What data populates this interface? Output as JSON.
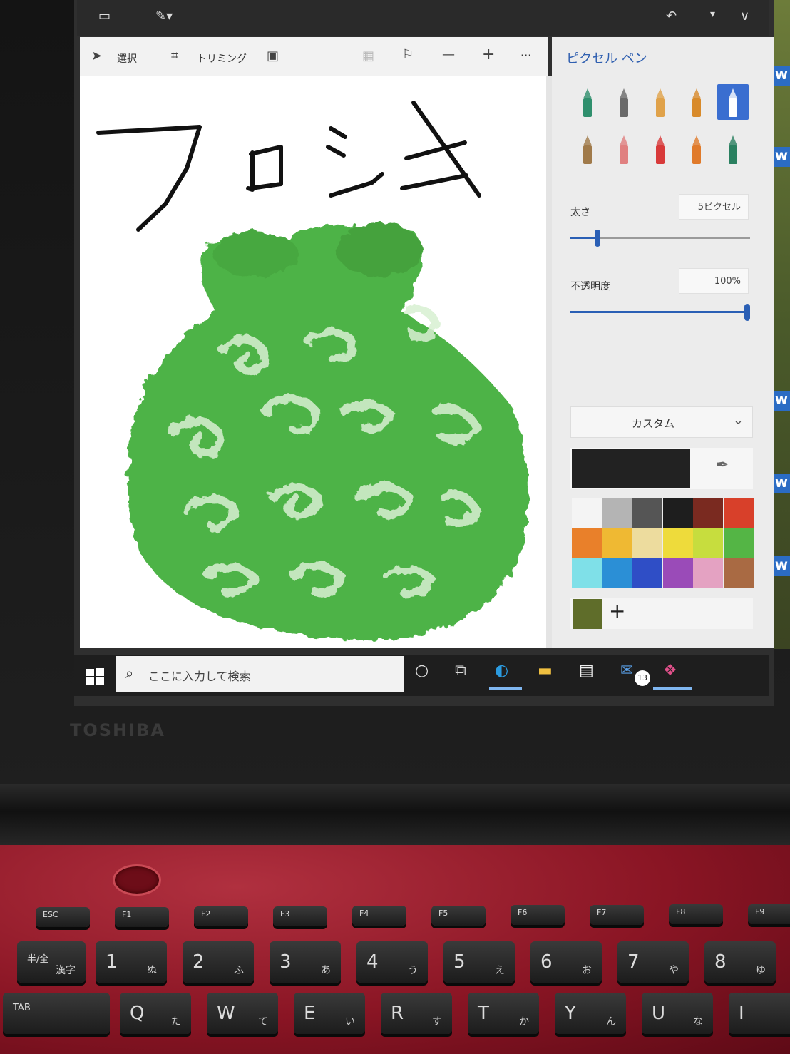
{
  "brand": "TOSHIBA",
  "paint_app": {
    "toolbar": {
      "select_label": "選択",
      "crop_label": "トリミング",
      "more_label": "···"
    },
    "canvas_text": "フロシキ",
    "panel": {
      "title": "ピクセル ペン",
      "thickness_label": "太さ",
      "thickness_value": "5ピクセル",
      "thickness_fraction": 0.05,
      "opacity_label": "不透明度",
      "opacity_value": "100%",
      "opacity_fraction": 1.0,
      "palette_dropdown": "カスタム",
      "current_color": "#222222",
      "palette_rows": [
        [
          "#f4f4f4",
          "#b4b4b4",
          "#555555",
          "#1e1e1e",
          "#7a2a20",
          "#d8402a"
        ],
        [
          "#e9802a",
          "#efb933",
          "#eddc9e",
          "#eedb3b",
          "#c7dd3e",
          "#54b545"
        ],
        [
          "#7fe0e8",
          "#2b8fd6",
          "#2f4ec6",
          "#9a4bb8",
          "#e4a2c2",
          "#a96a43"
        ]
      ],
      "custom_swatch": "#5f6d2a",
      "add_color_label": "+"
    },
    "brushes": [
      {
        "name": "marker-icon",
        "color": "#2f8f6d"
      },
      {
        "name": "calligraphy-pen-icon",
        "color": "#6a6a6a"
      },
      {
        "name": "oil-brush-icon",
        "color": "#e0a24a"
      },
      {
        "name": "watercolor-brush-icon",
        "color": "#d88a2a"
      },
      {
        "name": "pixel-pen-icon",
        "color": "#ffffff"
      },
      {
        "name": "pencil-icon",
        "color": "#a07a4a"
      },
      {
        "name": "eraser-icon",
        "color": "#e08080"
      },
      {
        "name": "crayon-icon",
        "color": "#d83a3a"
      },
      {
        "name": "spray-can-icon",
        "color": "#e07a2a"
      },
      {
        "name": "fill-bucket-icon",
        "color": "#2a8060"
      }
    ]
  },
  "taskbar": {
    "search_placeholder": "ここに入力して検索",
    "mail_badge": "13"
  },
  "desktop_tiles": [
    "W",
    "W",
    "W",
    "W",
    "W"
  ],
  "keyboard": {
    "fkeys": [
      "ESC",
      "F1",
      "F2",
      "F3",
      "F4",
      "F5",
      "F6",
      "F7",
      "F8",
      "F9"
    ],
    "numrow": [
      {
        "main": "半/全",
        "kana": "漢字"
      },
      {
        "main": "1",
        "kana": "ぬ"
      },
      {
        "main": "2",
        "kana": "ふ"
      },
      {
        "main": "3",
        "kana": "あ"
      },
      {
        "main": "4",
        "kana": "う"
      },
      {
        "main": "5",
        "kana": "え"
      },
      {
        "main": "6",
        "kana": "お"
      },
      {
        "main": "7",
        "kana": "や"
      },
      {
        "main": "8",
        "kana": "ゆ"
      }
    ],
    "qrow": [
      {
        "main": "TAB",
        "kana": ""
      },
      {
        "main": "Q",
        "kana": "た"
      },
      {
        "main": "W",
        "kana": "て"
      },
      {
        "main": "E",
        "kana": "い"
      },
      {
        "main": "R",
        "kana": "す"
      },
      {
        "main": "T",
        "kana": "か"
      },
      {
        "main": "Y",
        "kana": "ん"
      },
      {
        "main": "U",
        "kana": "な"
      },
      {
        "main": "I",
        "kana": ""
      }
    ]
  }
}
